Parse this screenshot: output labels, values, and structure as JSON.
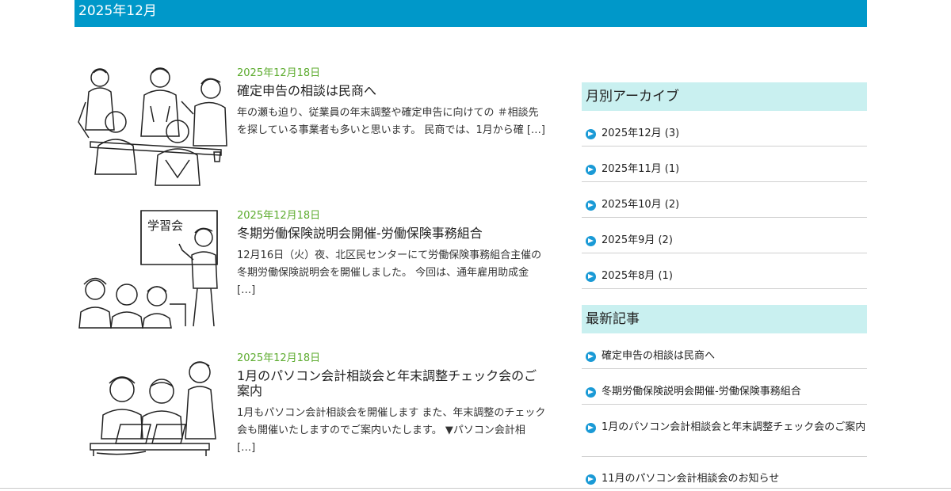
{
  "header": {
    "title": "2025年12月"
  },
  "posts": [
    {
      "date": "2025年12月18日",
      "title": "確定申告の相談は民商へ",
      "excerpt": "年の瀬も迫り、従業員の年末調整や確定申告に向けての ＃相談先 を探している事業者も多いと思います。 民商では、1月から確 […]",
      "image_icon": "meeting-illustration"
    },
    {
      "date": "2025年12月18日",
      "title": "冬期労働保険説明会開催-労働保険事務組合",
      "excerpt": "12月16日（火）夜、北区民センターにて労働保険事務組合主催の冬期労働保険説明会を開催しました。 今回は、通年雇用助成金 […]",
      "image_icon": "lecture-illustration",
      "image_text": "学習会"
    },
    {
      "date": "2025年12月18日",
      "title": "1月のパソコン会計相談会と年末調整チェック会のご案内",
      "excerpt": "1月もパソコン会計相談会を開催します また、年末調整のチェック会も開催いたしますのでご案内いたします。 ▼パソコン会計相 […]",
      "image_icon": "computer-class-illustration"
    }
  ],
  "sidebar": {
    "archive": {
      "heading": "月別アーカイブ",
      "items": [
        "2025年12月 (3)",
        "2025年11月 (1)",
        "2025年10月 (2)",
        "2025年9月 (2)",
        "2025年8月 (1)"
      ]
    },
    "recent": {
      "heading": "最新記事",
      "items": [
        "確定申告の相談は民商へ",
        "冬期労働保険説明会開催-労働保険事務組合",
        "1月のパソコン会計相談会と年末調整チェック会のご案内",
        "11月のパソコン会計相談会のお知らせ"
      ]
    }
  },
  "colors": {
    "header_bg": "#0098c9",
    "widget_head_bg": "#c9f0f0",
    "date_green": "#5cab2e",
    "arrow_blue": "#1a9ad6"
  }
}
